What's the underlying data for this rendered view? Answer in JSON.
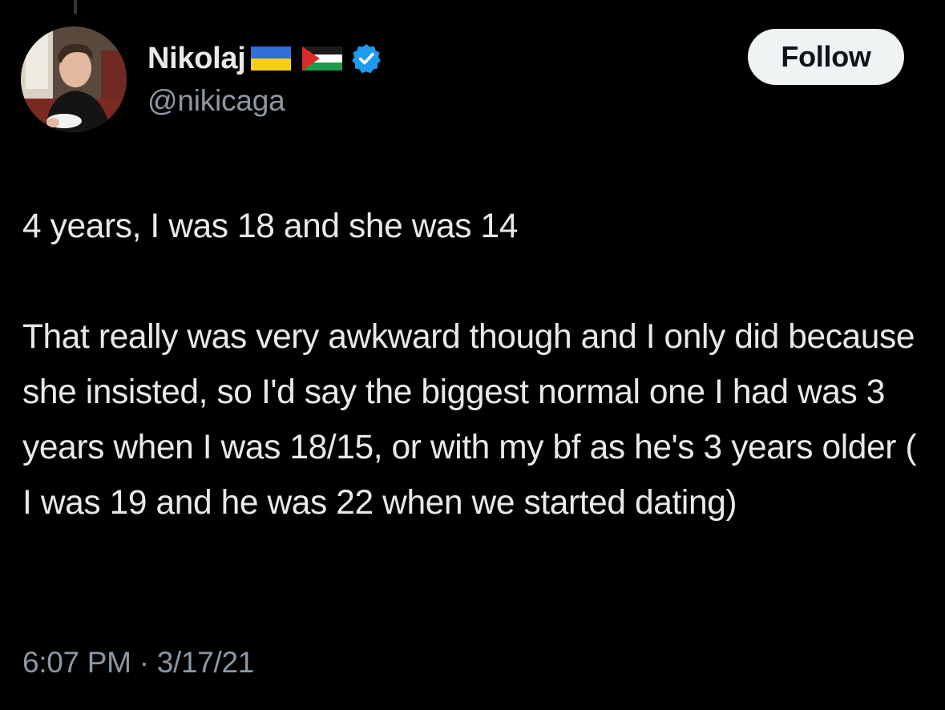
{
  "author": {
    "display_name": "Nikolaj",
    "handle": "@nikicaga",
    "flags": [
      "ukraine-flag",
      "palestine-flag"
    ],
    "verified": true,
    "avatar": "profile-photo"
  },
  "follow_button": {
    "label": "Follow"
  },
  "tweet": {
    "paragraphs": [
      "4 years, I was 18 and she was 14",
      "That really was very awkward though and I only did because she insisted, so I'd say the biggest normal one I had was 3 years when I was 18/15, or with my bf as he's 3 years older ( I was 19 and he was 22 when we started dating)"
    ]
  },
  "meta": {
    "time": "6:07 PM",
    "separator": "·",
    "date": "3/17/21"
  },
  "colors": {
    "background": "#000000",
    "text_primary": "#e7e9ea",
    "text_secondary": "#8b98a5",
    "verified_blue": "#1d9bf0",
    "follow_bg": "#eff3f4"
  }
}
